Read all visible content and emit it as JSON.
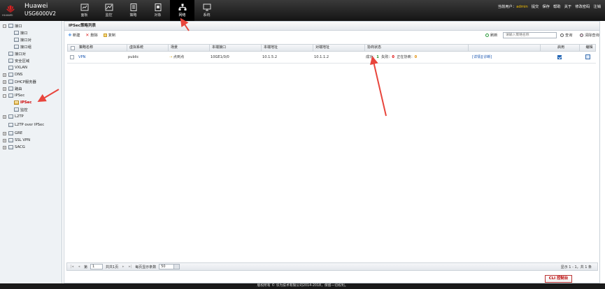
{
  "header": {
    "logo_text": "HUAWEI",
    "brand_name": "Huawei",
    "model": "USG6000V2",
    "nav": [
      {
        "label": "面板",
        "icon": "dashboard-icon"
      },
      {
        "label": "监控",
        "icon": "monitor-icon"
      },
      {
        "label": "策略",
        "icon": "policy-icon"
      },
      {
        "label": "对象",
        "icon": "object-icon"
      },
      {
        "label": "网络",
        "icon": "network-icon"
      },
      {
        "label": "系统",
        "icon": "system-icon"
      }
    ],
    "active_nav": "网络",
    "user_prefix": "当前用户：",
    "user": "admin",
    "actions": [
      "提交",
      "保存",
      "帮助",
      "关于",
      "修改密码",
      "注销"
    ]
  },
  "sidebar": {
    "items": [
      {
        "label": "接口",
        "toggle": "−",
        "level": 0
      },
      {
        "label": "接口",
        "level": 1
      },
      {
        "label": "接口对",
        "level": 1
      },
      {
        "label": "接口组",
        "level": 1
      },
      {
        "label": "接口对",
        "level": 0
      },
      {
        "label": "安全区域",
        "level": 0
      },
      {
        "label": "VXLAN",
        "level": 0
      },
      {
        "label": "DNS",
        "toggle": "+",
        "level": 0
      },
      {
        "label": "DHCP服务器",
        "toggle": "+",
        "level": 0
      },
      {
        "label": "路由",
        "toggle": "+",
        "level": 0
      },
      {
        "label": "IPSec",
        "toggle": "−",
        "level": 0
      },
      {
        "label": "IPSec",
        "level": 1,
        "selected": true
      },
      {
        "label": "监控",
        "level": 1
      },
      {
        "label": "L2TP",
        "toggle": "+",
        "level": 0
      },
      {
        "label": "L2TP over IPSec",
        "level": 0
      },
      {
        "label": "GRE",
        "toggle": "+",
        "level": 0
      },
      {
        "label": "SSL VPN",
        "toggle": "+",
        "level": 0
      },
      {
        "label": "SACG",
        "toggle": "+",
        "level": 0
      }
    ]
  },
  "panel": {
    "title": "IPSec策略列表",
    "toolbar": {
      "new": "新建",
      "delete": "删除",
      "copy": "复制",
      "refresh": "刷新",
      "search_placeholder": "请输入策略名称",
      "query": "查询",
      "clear": "清除查询"
    },
    "columns": [
      "策略名称",
      "虚拟系统",
      "场景",
      "本端接口",
      "本端地址",
      "对端地址",
      "协商状态",
      "",
      "启用",
      "编辑"
    ],
    "rows": [
      {
        "name": "VPN",
        "vsys": "public",
        "scene": "点到点",
        "local_if": "10GE1/0/0",
        "local_addr": "10.1.5.2",
        "peer_addr": "10.1.1.2",
        "status_success_label": "成功：",
        "success": "1",
        "status_fail_label": "失败：",
        "fail": "0",
        "status_negotiating_label": "正在协商：",
        "negotiating": "0",
        "detail_link": "[详情][诊断]",
        "enabled": true
      }
    ],
    "pager": {
      "page_label": "第",
      "page": "1",
      "total_pages": "共共1页",
      "per_page_label": "每页显示条数",
      "per_page": "50",
      "info": "显示 1 - 1，共 1 条"
    }
  },
  "cli_button": "CLI 控制台",
  "footer": "版权所有 © 华为技术有限公司2014-2018，保留一切权利。",
  "colors": {
    "topbar": "#1a1a1a",
    "accent_user": "#f5c000",
    "annotation": "#e8453c",
    "link": "#1a56b0"
  }
}
